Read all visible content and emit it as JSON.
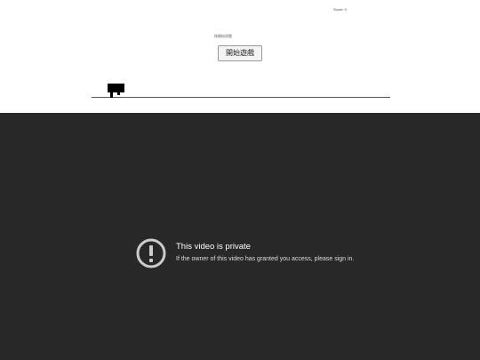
{
  "game": {
    "score_text": "Score: 0",
    "status_text": "按開始遊戲",
    "start_button_label": "開始遊戲",
    "player_icon": "pixel-character-icon"
  },
  "video": {
    "title": "This video is private",
    "message": "If the owner of this video has granted you access, please sign in.",
    "icon": "alert-circle-icon"
  },
  "colors": {
    "game_background": "#ffffff",
    "ground": "#555555",
    "player": "#000000",
    "video_background": "#282828",
    "icon": "#cccccc"
  }
}
